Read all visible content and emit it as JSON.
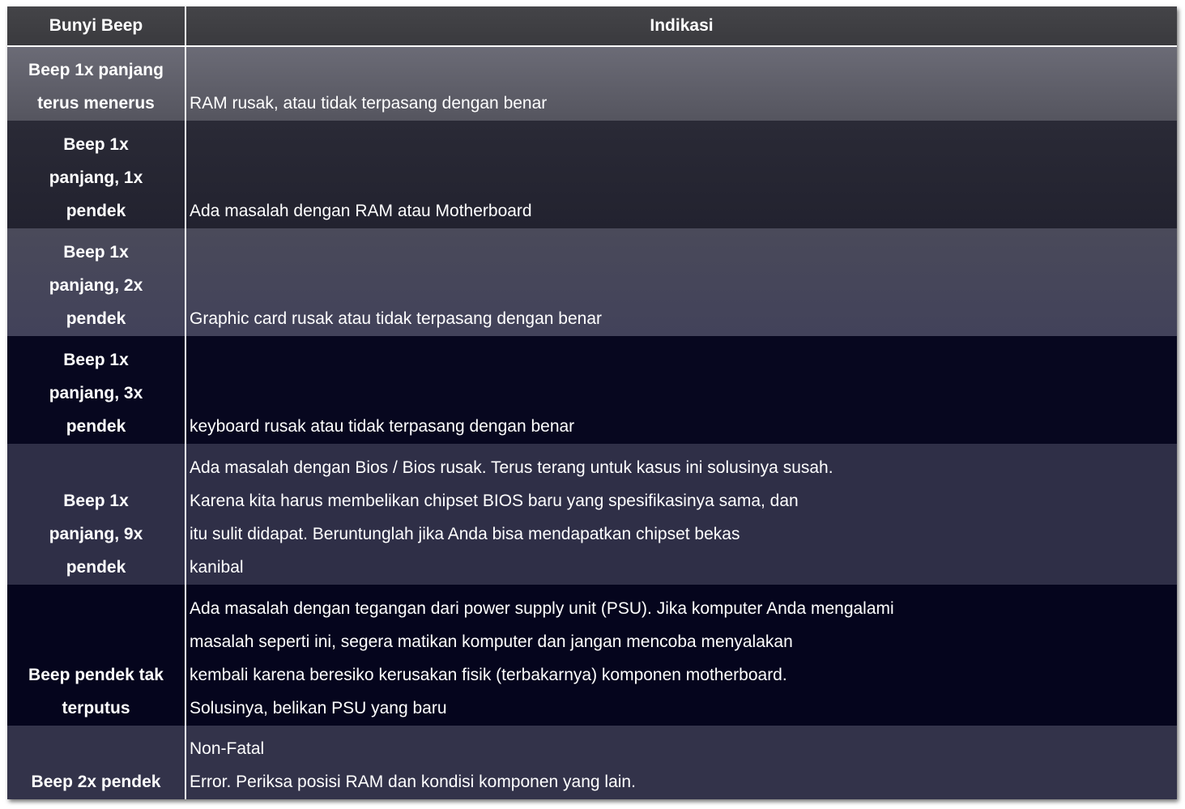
{
  "table": {
    "headers": {
      "col1": "Bunyi Beep",
      "col2": "Indikasi"
    },
    "rows": [
      {
        "beep": [
          "Beep 1x panjang",
          "terus menerus"
        ],
        "indikasi": [
          "RAM rusak, atau tidak terpasang dengan benar"
        ]
      },
      {
        "beep": [
          "Beep 1x",
          "panjang, 1x",
          "pendek"
        ],
        "indikasi": [
          "Ada masalah dengan RAM atau Motherboard"
        ]
      },
      {
        "beep": [
          "Beep 1x",
          "panjang, 2x",
          "pendek"
        ],
        "indikasi": [
          "Graphic card rusak atau tidak terpasang dengan benar"
        ]
      },
      {
        "beep": [
          "Beep 1x",
          "panjang, 3x",
          "pendek"
        ],
        "indikasi": [
          "keyboard rusak atau tidak terpasang dengan benar"
        ]
      },
      {
        "beep": [
          "Beep 1x",
          "panjang, 9x",
          "pendek"
        ],
        "indikasi": [
          "Ada masalah dengan Bios / Bios rusak. Terus terang untuk kasus ini solusinya susah.",
          "Karena kita harus membelikan chipset BIOS baru yang spesifikasinya sama, dan",
          "itu sulit didapat. Beruntunglah jika Anda bisa mendapatkan chipset bekas",
          "kanibal"
        ]
      },
      {
        "beep": [
          "Beep pendek tak",
          "terputus"
        ],
        "indikasi": [
          "Ada masalah dengan tegangan dari power supply unit (PSU). Jika komputer Anda mengalami",
          "masalah seperti ini, segera matikan komputer dan jangan mencoba menyalakan",
          "kembali karena beresiko kerusakan fisik (terbakarnya) komponen motherboard.",
          "Solusinya, belikan PSU yang baru"
        ]
      },
      {
        "beep": [
          "Beep 2x pendek"
        ],
        "indikasi": [
          "Non-Fatal",
          "Error. Periksa posisi RAM dan kondisi komponen yang lain."
        ]
      }
    ]
  }
}
